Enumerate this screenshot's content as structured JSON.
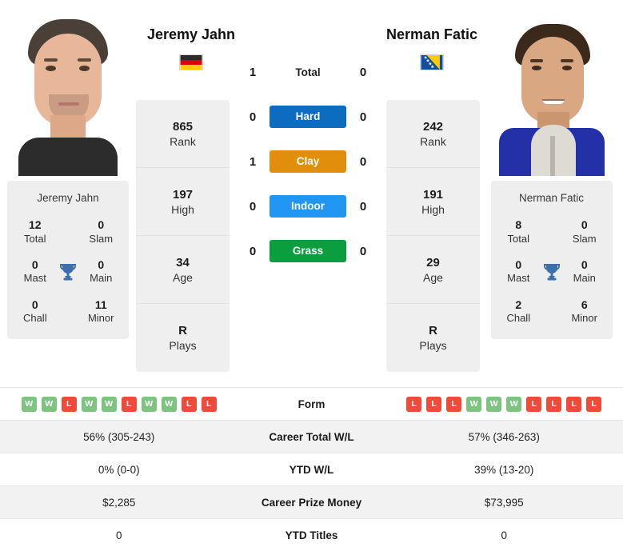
{
  "players": {
    "left": {
      "name": "Jeremy Jahn",
      "country": "Germany",
      "flag_icon": "flag-germany",
      "photo_alt": "Jeremy Jahn headshot",
      "card_name": "Jeremy Jahn",
      "rank": "865",
      "rank_label": "Rank",
      "high": "197",
      "high_label": "High",
      "age": "34",
      "age_label": "Age",
      "plays": "R",
      "plays_label": "Plays",
      "titles": {
        "total": "12",
        "total_label": "Total",
        "slam": "0",
        "slam_label": "Slam",
        "mast": "0",
        "mast_label": "Mast",
        "main": "0",
        "main_label": "Main",
        "chall": "0",
        "chall_label": "Chall",
        "minor": "11",
        "minor_label": "Minor"
      },
      "h2h": {
        "total": "1",
        "hard": "0",
        "clay": "1",
        "indoor": "0",
        "grass": "0"
      },
      "form": [
        "W",
        "W",
        "L",
        "W",
        "W",
        "L",
        "W",
        "W",
        "L",
        "L"
      ],
      "career_total_wl": "56% (305-243)",
      "ytd_wl": "0% (0-0)",
      "career_prize_money": "$2,285",
      "ytd_titles": "0"
    },
    "right": {
      "name": "Nerman Fatic",
      "country": "Bosnia and Herzegovina",
      "flag_icon": "flag-bosnia-herzegovina",
      "photo_alt": "Nerman Fatic headshot",
      "card_name": "Nerman Fatic",
      "rank": "242",
      "rank_label": "Rank",
      "high": "191",
      "high_label": "High",
      "age": "29",
      "age_label": "Age",
      "plays": "R",
      "plays_label": "Plays",
      "titles": {
        "total": "8",
        "total_label": "Total",
        "slam": "0",
        "slam_label": "Slam",
        "mast": "0",
        "mast_label": "Mast",
        "main": "0",
        "main_label": "Main",
        "chall": "2",
        "chall_label": "Chall",
        "minor": "6",
        "minor_label": "Minor"
      },
      "h2h": {
        "total": "0",
        "hard": "0",
        "clay": "0",
        "indoor": "0",
        "grass": "0"
      },
      "form": [
        "L",
        "L",
        "L",
        "W",
        "W",
        "W",
        "L",
        "L",
        "L",
        "L"
      ],
      "career_total_wl": "57% (346-263)",
      "ytd_wl": "39% (13-20)",
      "career_prize_money": "$73,995",
      "ytd_titles": "0"
    }
  },
  "h2h_rows": [
    {
      "key": "total",
      "label": "Total",
      "pill": false,
      "color": ""
    },
    {
      "key": "hard",
      "label": "Hard",
      "pill": true,
      "color": "#0c6cc0"
    },
    {
      "key": "clay",
      "label": "Clay",
      "pill": true,
      "color": "#e08e0b"
    },
    {
      "key": "indoor",
      "label": "Indoor",
      "pill": true,
      "color": "#2196f3"
    },
    {
      "key": "grass",
      "label": "Grass",
      "pill": true,
      "color": "#0a9e3e"
    }
  ],
  "table_labels": {
    "form": "Form",
    "career_total_wl": "Career Total W/L",
    "ytd_wl": "YTD W/L",
    "career_prize_money": "Career Prize Money",
    "ytd_titles": "YTD Titles"
  },
  "colors": {
    "hard": "#0c6cc0",
    "clay": "#e08e0b",
    "indoor": "#2196f3",
    "grass": "#0a9e3e",
    "win_badge": "#7cc47f",
    "loss_badge": "#ef4b3a",
    "card_bg": "#eeeeee",
    "row_shade": "#f2f2f2",
    "trophy": "#3d6fae"
  },
  "icons": {
    "trophy": "trophy-icon"
  }
}
